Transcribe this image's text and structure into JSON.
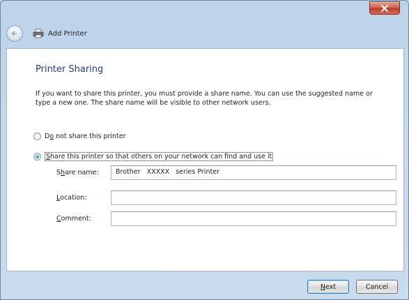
{
  "window": {
    "close_icon": "close-x-icon"
  },
  "nav": {
    "back_icon": "back-arrow-icon",
    "title_icon": "printer-icon",
    "title": "Add Printer"
  },
  "page": {
    "title": "Printer Sharing",
    "intro": "If you want to share this printer, you must provide a share name. You can use the suggested name or type a new one. The share name will be visible to other network users."
  },
  "options": {
    "do_not_share": {
      "prefix": "D",
      "accel": "o",
      "rest": " not share this printer",
      "selected": false
    },
    "share": {
      "prefix": "",
      "accel": "S",
      "rest": "hare this printer so that others on your network can find and use it",
      "selected": true
    }
  },
  "fields": {
    "share_name": {
      "label_accel": "h",
      "label_pre": "S",
      "label_post": "are name:",
      "value": "Brother   XXXXX   series Printer"
    },
    "location": {
      "label_accel": "L",
      "label_pre": "",
      "label_post": "ocation:",
      "value": ""
    },
    "comment": {
      "label_accel": "C",
      "label_pre": "",
      "label_post": "omment:",
      "value": ""
    }
  },
  "buttons": {
    "next_accel": "N",
    "next_rest": "ext",
    "cancel": "Cancel"
  }
}
